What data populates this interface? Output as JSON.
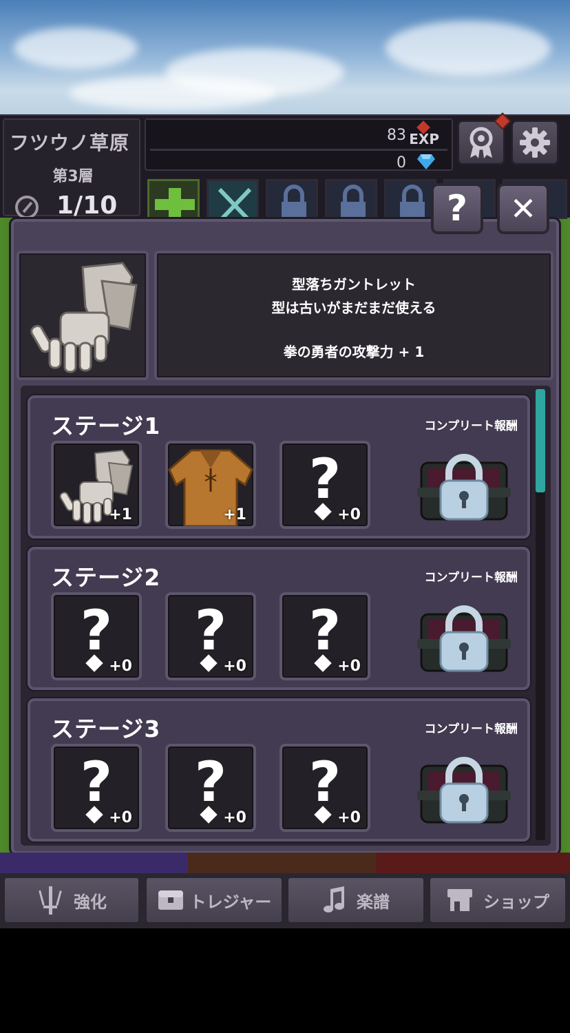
{
  "hud": {
    "area_name": "フツウノ草原",
    "floor": "第3層",
    "progress": "1/10",
    "exp_value": "83",
    "exp_label": "EXP",
    "gem_value": "0"
  },
  "modal": {
    "help_label": "?",
    "close_label": "✕",
    "item": {
      "name": "型落ちガントレット",
      "flavor": "型は古いがまだまだ使える",
      "effect": "拳の勇者の攻撃力 + 1"
    }
  },
  "stages": [
    {
      "title": "ステージ1",
      "reward_label": "コンプリート報酬",
      "slots": [
        {
          "icon": "gauntlet-icon",
          "count": "+1"
        },
        {
          "icon": "tunic-icon",
          "count": "+1"
        },
        {
          "icon": "unknown-icon",
          "count": "+0"
        }
      ]
    },
    {
      "title": "ステージ2",
      "reward_label": "コンプリート報酬",
      "slots": [
        {
          "icon": "unknown-icon",
          "count": "+0"
        },
        {
          "icon": "unknown-icon",
          "count": "+0"
        },
        {
          "icon": "unknown-icon",
          "count": "+0"
        }
      ]
    },
    {
      "title": "ステージ3",
      "reward_label": "コンプリート報酬",
      "slots": [
        {
          "icon": "unknown-icon",
          "count": "+0"
        },
        {
          "icon": "unknown-icon",
          "count": "+0"
        },
        {
          "icon": "unknown-icon",
          "count": "+0"
        }
      ]
    }
  ],
  "scroll_position": 0.0,
  "bottom_tabs": [
    {
      "label": "強化",
      "icon": "sword-icon"
    },
    {
      "label": "トレジャー",
      "icon": "treasure-icon"
    },
    {
      "label": "楽譜",
      "icon": "music-note-icon"
    },
    {
      "label": "ショップ",
      "icon": "shop-icon"
    }
  ],
  "colors": {
    "accent_scroll": "#2fa7a0",
    "notification": "#c0392b",
    "panel": "#4a4258"
  }
}
